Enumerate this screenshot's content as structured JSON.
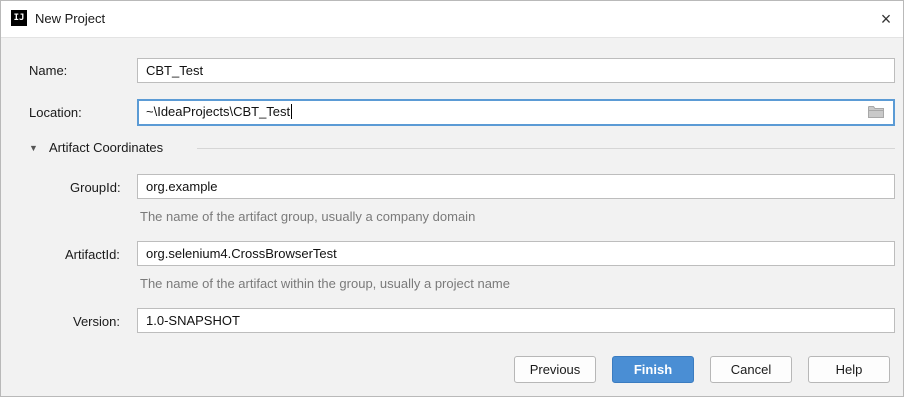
{
  "window": {
    "title": "New Project",
    "app_icon_text": "IJ",
    "close_glyph": "×"
  },
  "form": {
    "name_label": "Name:",
    "name_value": "CBT_Test",
    "location_label": "Location:",
    "location_value": "~\\IdeaProjects\\CBT_Test"
  },
  "artifact": {
    "section_arrow": "▼",
    "section_title": "Artifact Coordinates",
    "group_id_label": "GroupId:",
    "group_id_value": "org.example",
    "group_id_hint": "The name of the artifact group, usually a company domain",
    "artifact_id_label": "ArtifactId:",
    "artifact_id_value": "org.selenium4.CrossBrowserTest",
    "artifact_id_hint": "The name of the artifact within the group, usually a project name",
    "version_label": "Version:",
    "version_value": "1.0-SNAPSHOT"
  },
  "buttons": {
    "previous": "Previous",
    "finish": "Finish",
    "cancel": "Cancel",
    "help": "Help"
  },
  "icons": {
    "browse": "folder-icon",
    "close": "close-icon",
    "expand": "expand-arrow-icon"
  },
  "colors": {
    "accent": "#4a8ed4",
    "focus_border": "#5b9bd5",
    "hint_text": "#7a7a7a"
  }
}
